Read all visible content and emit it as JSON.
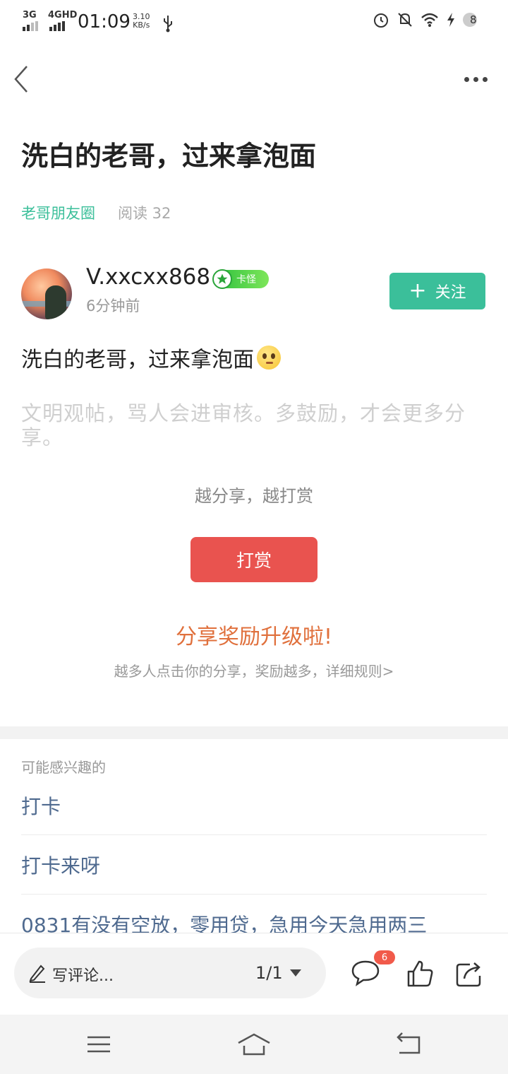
{
  "status_bar": {
    "network1": "3G",
    "network2": "4GHD",
    "time": "01:09",
    "speed_value": "3.10",
    "speed_unit": "KB/s",
    "battery_level": "8"
  },
  "post": {
    "title": "洗白的老哥，过来拿泡面",
    "circle": "老哥朋友圈",
    "reads": "阅读 32",
    "author": {
      "name": "V.xxcxx868",
      "badge": "卡怪",
      "time": "6分钟前"
    },
    "follow_label": "关注",
    "body": "洗白的老哥，过来拿泡面",
    "civility_notice": "文明观帖，骂人会进审核。多鼓励，才会更多分享。"
  },
  "reward": {
    "prompt": "越分享，越打赏",
    "button": "打赏",
    "upgrade_title": "分享奖励升级啦!",
    "upgrade_sub": "越多人点击你的分享，奖励越多，详细规则>"
  },
  "recommend": {
    "heading": "可能感兴趣的",
    "items": [
      "打卡",
      "打卡来呀",
      "0831有没有空放，零用贷，急用今天急用两三"
    ]
  },
  "bottom_bar": {
    "comment_placeholder": "写评论...",
    "page": "1/1",
    "comment_count": "6"
  },
  "colors": {
    "accent_green": "#3bbf9a",
    "reward_red": "#e9534f",
    "upgrade_orange": "#e0703c",
    "link_blue": "#4f6a8f"
  }
}
